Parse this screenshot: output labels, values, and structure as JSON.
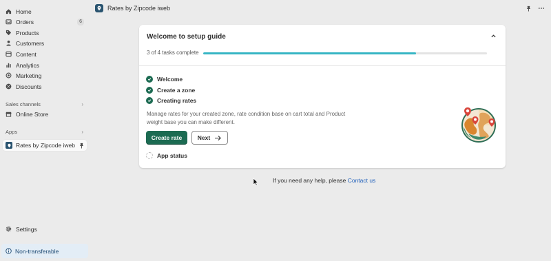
{
  "sidebar": {
    "items": [
      {
        "label": "Home",
        "icon": "home-icon"
      },
      {
        "label": "Orders",
        "icon": "orders-icon",
        "badge": "6"
      },
      {
        "label": "Products",
        "icon": "tag-icon"
      },
      {
        "label": "Customers",
        "icon": "person-icon"
      },
      {
        "label": "Content",
        "icon": "content-icon"
      },
      {
        "label": "Analytics",
        "icon": "bar-chart-icon"
      },
      {
        "label": "Marketing",
        "icon": "target-icon"
      },
      {
        "label": "Discounts",
        "icon": "discount-icon"
      }
    ],
    "sales_channels_label": "Sales channels",
    "online_store_label": "Online Store",
    "apps_label": "Apps",
    "active_app_label": "Rates by Zipcode iweb",
    "settings_label": "Settings",
    "non_transferable_label": "Non-transferable"
  },
  "topbar": {
    "title": "Rates by Zipcode iweb"
  },
  "guide": {
    "title": "Welcome to setup guide",
    "progress_text": "3 of 4 tasks complete",
    "progress": 0.75,
    "tasks": [
      {
        "label": "Welcome",
        "done": true
      },
      {
        "label": "Create a zone",
        "done": true
      },
      {
        "label": "Creating rates",
        "done": true
      },
      {
        "label": "App status",
        "done": false
      }
    ],
    "description": "Manage rates for your created zone, rate condition base on cart total and Product weight base you can make different.",
    "primary_button": "Create rate",
    "secondary_button": "Next"
  },
  "help": {
    "text": "If you need any help, please ",
    "link": "Contact us"
  },
  "colors": {
    "primary": "#1c6b52",
    "progress": "#36b5c4",
    "link": "#2463bc",
    "non_transferable_bg": "#e3edf6"
  }
}
